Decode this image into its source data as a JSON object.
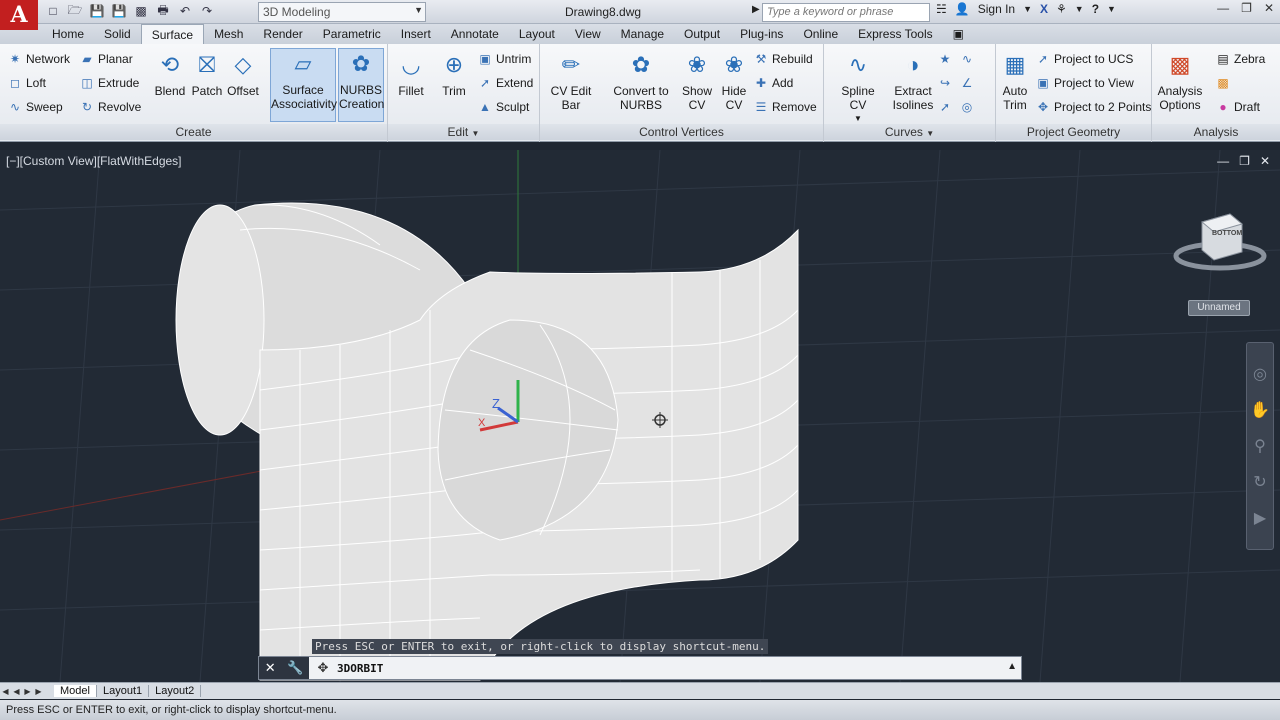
{
  "title_bar": {
    "workspace": "3D Modeling",
    "document": "Drawing8.dwg",
    "search_placeholder": "Type a keyword or phrase",
    "sign_in": "Sign In"
  },
  "tabs": [
    "Home",
    "Solid",
    "Surface",
    "Mesh",
    "Render",
    "Parametric",
    "Insert",
    "Annotate",
    "Layout",
    "View",
    "Manage",
    "Output",
    "Plug-ins",
    "Online",
    "Express Tools"
  ],
  "active_tab": "Surface",
  "create_panel": {
    "title": "Create",
    "small_left": [
      "Network",
      "Loft",
      "Sweep"
    ],
    "small_right": [
      "Planar",
      "Extrude",
      "Revolve"
    ],
    "big": [
      "Blend",
      "Patch",
      "Offset"
    ],
    "surface_assoc": [
      "Surface",
      "Associativity"
    ],
    "nurbs_creation": [
      "NURBS",
      "Creation"
    ]
  },
  "edit_panel": {
    "title": "Edit",
    "big": [
      "Fillet",
      "Trim"
    ],
    "small": [
      "Untrim",
      "Extend",
      "Sculpt"
    ]
  },
  "cv_panel": {
    "title": "Control Vertices",
    "cv_edit_bar": "CV Edit Bar",
    "convert": [
      "Convert to",
      "NURBS"
    ],
    "show_cv": [
      "Show",
      "CV"
    ],
    "hide_cv": [
      "Hide",
      "CV"
    ],
    "small": [
      "Rebuild",
      "Add",
      "Remove"
    ]
  },
  "curves_panel": {
    "title": "Curves",
    "spline_cv": "Spline CV",
    "extract": [
      "Extract",
      "Isolines"
    ]
  },
  "projgeom_panel": {
    "title": "Project Geometry",
    "auto_trim": [
      "Auto",
      "Trim"
    ],
    "small": [
      "Project to UCS",
      "Project to View",
      "Project to 2 Points"
    ]
  },
  "analysis_panel": {
    "title": "Analysis",
    "options": [
      "Analysis",
      "Options"
    ],
    "small": [
      "Zebra",
      "",
      "Draft"
    ]
  },
  "viewport": {
    "label": "[−][Custom View][FlatWithEdges]",
    "viewcube_face": "BOTTOM",
    "unnamed": "Unnamed",
    "prompt": "Press ESC or ENTER to exit, or right-click to display shortcut-menu."
  },
  "command_line": {
    "text": "3DORBIT"
  },
  "layout_tabs": [
    "Model",
    "Layout1",
    "Layout2"
  ],
  "status": "Press ESC or ENTER to exit, or right-click to display shortcut-menu.",
  "colors": {
    "accent_red": "#c21f1f",
    "ribbon_blue": "#2a6fb8",
    "viewport_bg": "#222a35",
    "selected_bg": "#c9dcf2"
  }
}
